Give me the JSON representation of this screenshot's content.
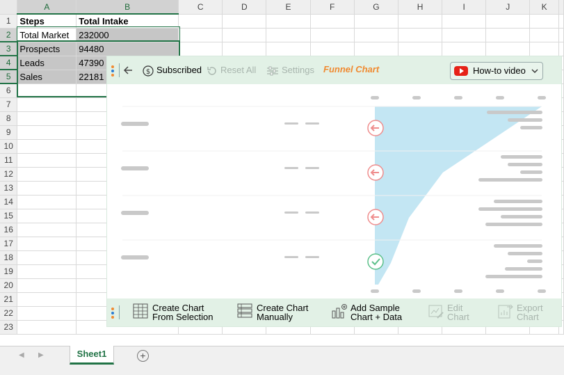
{
  "sheet": {
    "columns": [
      "A",
      "B",
      "C",
      "D",
      "E",
      "F",
      "G",
      "H",
      "I",
      "J",
      "K"
    ],
    "rows": [
      "1",
      "2",
      "3",
      "4",
      "5",
      "6",
      "7",
      "8",
      "9",
      "10",
      "11",
      "12",
      "13",
      "14",
      "15",
      "16",
      "17",
      "18",
      "19",
      "20",
      "21",
      "22",
      "23"
    ],
    "cells": {
      "header": [
        "Steps",
        "Total Intake"
      ],
      "data": [
        [
          "Total Market",
          "232000"
        ],
        [
          "Prospects",
          "94480"
        ],
        [
          "Leads",
          "47390"
        ],
        [
          "Sales",
          "22181"
        ]
      ]
    },
    "tab_name": "Sheet1",
    "colors": {
      "accent": "#217346",
      "selection": "#c6c6c6"
    }
  },
  "panel": {
    "subscribed_label": "Subscribed",
    "reset_label": "Reset All",
    "settings_label": "Settings",
    "title": "Funnel Chart",
    "howto_label": "How-to video",
    "actions": [
      {
        "line1": "Create Chart",
        "line2": "From Selection",
        "icon": "table-icon",
        "enabled": true
      },
      {
        "line1": "Create Chart",
        "line2": "Manually",
        "icon": "list-icon",
        "enabled": true
      },
      {
        "line1": "Add Sample",
        "line2": "Chart + Data",
        "icon": "sample-chart-icon",
        "enabled": true
      },
      {
        "line1": "Edit",
        "line2": "Chart",
        "icon": "edit-chart-icon",
        "enabled": false
      },
      {
        "line1": "Export",
        "line2": "Chart",
        "icon": "export-chart-icon",
        "enabled": false
      }
    ],
    "colors": {
      "bar_bg": "#e2f1e6",
      "title": "#f08a31",
      "funnel_fill": "#c3e6f3",
      "placeholder": "#c9c9c9",
      "arrow_marker": "#ef8d8d",
      "check_marker": "#5cc08a"
    }
  },
  "chart_data": {
    "type": "area",
    "values": [
      232000,
      94480,
      47390,
      22181
    ],
    "markers": [
      "arrow",
      "arrow",
      "arrow",
      "check"
    ]
  }
}
